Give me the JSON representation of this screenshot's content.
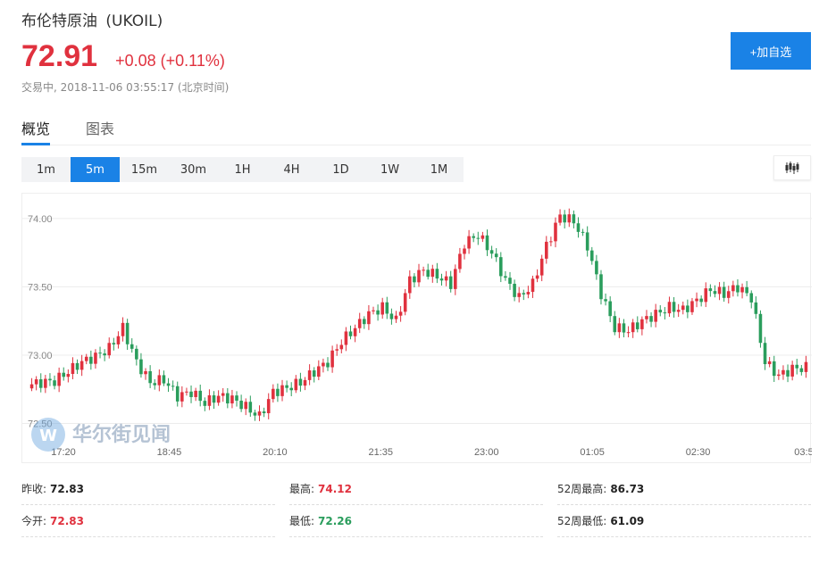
{
  "instrument": {
    "name": "布伦特原油",
    "symbol": "(UKOIL)",
    "price": "72.91",
    "change": "+0.08 (+0.11%)",
    "status": "交易中, 2018-11-06 03:55:17 (北京时间)"
  },
  "actions": {
    "add_watchlist": "+加自选"
  },
  "tabs": [
    {
      "label": "概览",
      "active": true
    },
    {
      "label": "图表",
      "active": false
    }
  ],
  "intervals": [
    "1m",
    "5m",
    "15m",
    "30m",
    "1H",
    "4H",
    "1D",
    "1W",
    "1M"
  ],
  "active_interval": "5m",
  "chart_type_icon": "candlestick-icon",
  "colors": {
    "up": "#e0313e",
    "down": "#2a9d5c",
    "accent": "#1a82e6"
  },
  "watermark": "华尔街见闻",
  "chart_data": {
    "type": "candlestick",
    "y_ticks": [
      "74.00",
      "73.50",
      "73.00",
      "72.50"
    ],
    "y_tick_values": [
      74.0,
      73.5,
      73.0,
      72.5
    ],
    "x_ticks": [
      "17:20",
      "18:45",
      "20:10",
      "21:35",
      "23:00",
      "01:05",
      "02:30",
      "03:5"
    ],
    "ylim": [
      72.34,
      74.13
    ],
    "grid": true,
    "close_series": [
      72.8,
      72.81,
      72.88,
      72.95,
      72.99,
      73.05,
      73.2,
      72.95,
      72.8,
      72.82,
      72.7,
      72.73,
      72.65,
      72.7,
      72.68,
      72.62,
      72.55,
      72.73,
      72.76,
      72.8,
      72.88,
      72.95,
      73.1,
      73.2,
      73.3,
      73.35,
      73.25,
      73.55,
      73.62,
      73.58,
      73.52,
      73.82,
      73.88,
      73.75,
      73.55,
      73.42,
      73.52,
      73.8,
      74.02,
      73.98,
      73.8,
      73.45,
      73.2,
      73.18,
      73.25,
      73.3,
      73.35,
      73.33,
      73.4,
      73.48,
      73.45,
      73.5,
      73.42,
      72.95,
      72.85,
      72.9,
      72.91
    ]
  },
  "stats": [
    {
      "label": "昨收:",
      "value": "72.83",
      "tone": ""
    },
    {
      "label": "最高:",
      "value": "74.12",
      "tone": "red"
    },
    {
      "label": "52周最高:",
      "value": "86.73",
      "tone": ""
    },
    {
      "label": "今开:",
      "value": "72.83",
      "tone": "red"
    },
    {
      "label": "最低:",
      "value": "72.26",
      "tone": "green"
    },
    {
      "label": "52周最低:",
      "value": "61.09",
      "tone": ""
    }
  ]
}
